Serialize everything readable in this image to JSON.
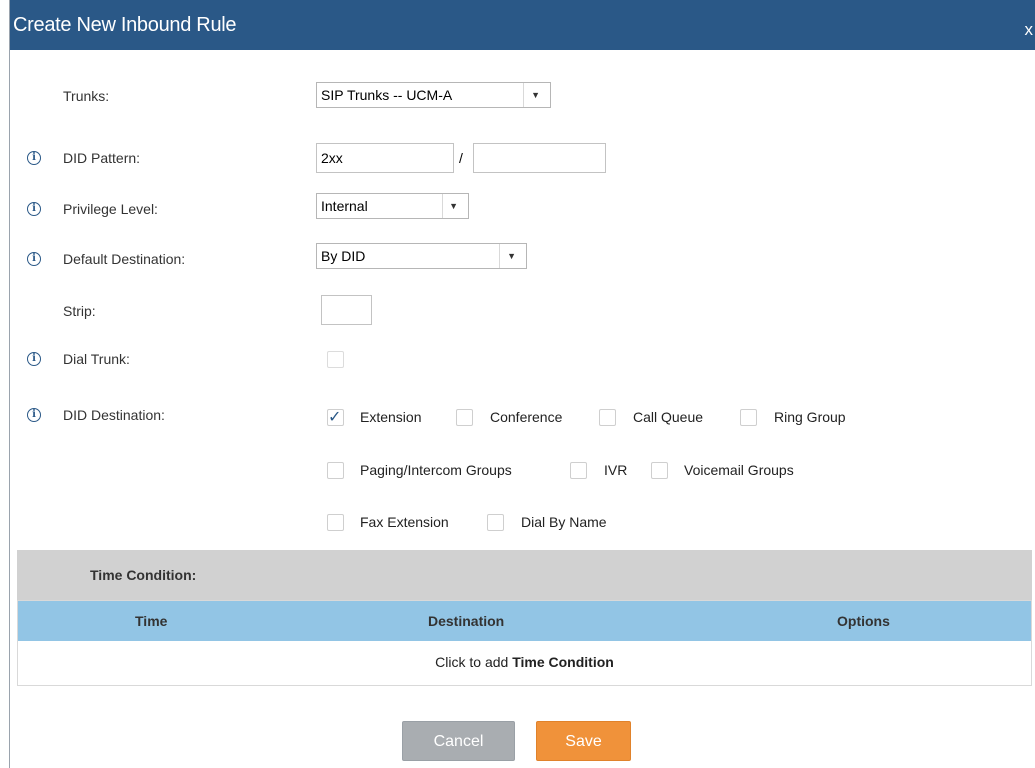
{
  "dialog": {
    "title": "Create New Inbound Rule",
    "close_label": "x"
  },
  "form": {
    "trunks": {
      "label": "Trunks:",
      "value": "SIP Trunks -- UCM-A"
    },
    "did_pattern": {
      "label": "DID Pattern:",
      "value": "2xx",
      "separator": "/",
      "value2": ""
    },
    "privilege_level": {
      "label": "Privilege Level:",
      "value": "Internal"
    },
    "default_destination": {
      "label": "Default Destination:",
      "value": "By DID"
    },
    "strip": {
      "label": "Strip:",
      "value": ""
    },
    "dial_trunk": {
      "label": "Dial Trunk:",
      "checked": false
    },
    "did_destination": {
      "label": "DID Destination:",
      "options": [
        {
          "label": "Extension",
          "checked": true
        },
        {
          "label": "Conference",
          "checked": false
        },
        {
          "label": "Call Queue",
          "checked": false
        },
        {
          "label": "Ring Group",
          "checked": false
        },
        {
          "label": "Paging/Intercom Groups",
          "checked": false
        },
        {
          "label": "IVR",
          "checked": false
        },
        {
          "label": "Voicemail Groups",
          "checked": false
        },
        {
          "label": "Fax Extension",
          "checked": false
        },
        {
          "label": "Dial By Name",
          "checked": false
        }
      ]
    }
  },
  "time_condition": {
    "title": "Time Condition:",
    "columns": [
      "Time",
      "Destination",
      "Options"
    ],
    "empty_prefix": "Click to add ",
    "empty_bold": "Time Condition"
  },
  "buttons": {
    "cancel": "Cancel",
    "save": "Save"
  },
  "icons": {
    "info": "info-icon",
    "dropdown": "chevron-down-icon",
    "check": "check-icon",
    "close": "close-icon"
  },
  "colors": {
    "titlebar": "#2a5887",
    "table_header": "#92c5e5",
    "save": "#f0923a",
    "cancel": "#a9adb1"
  }
}
